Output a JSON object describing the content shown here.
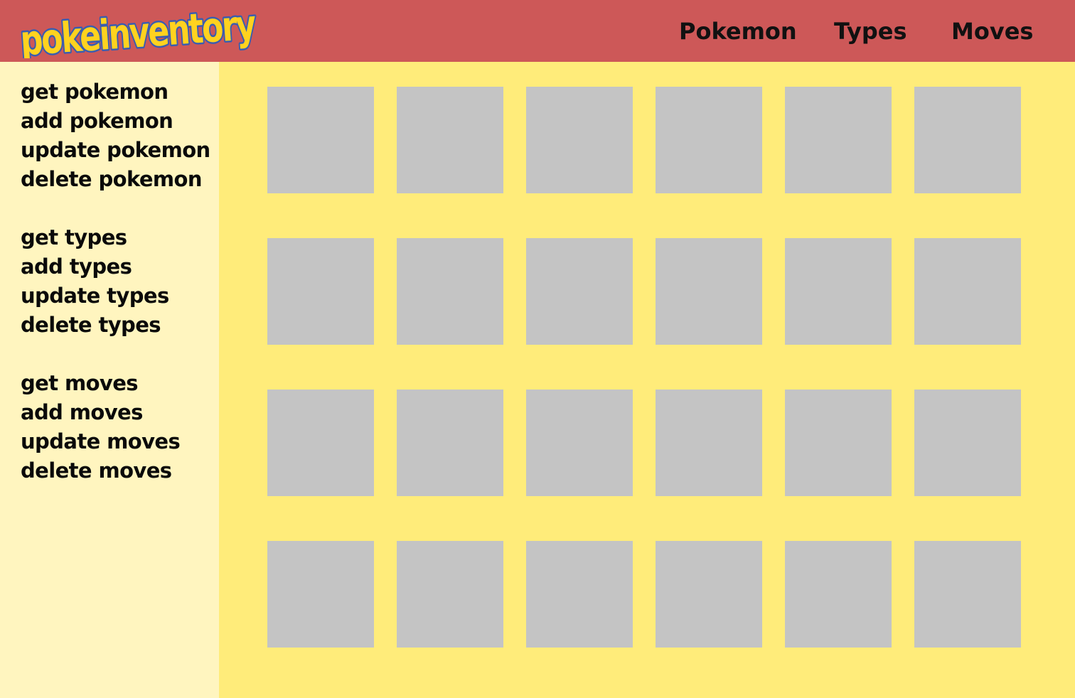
{
  "app": {
    "logo_text": "pokeinventory"
  },
  "nav": {
    "pokemon": "Pokemon",
    "types": "Types",
    "moves": "Moves"
  },
  "sidebar": {
    "groups": [
      {
        "items": [
          "get pokemon",
          "add pokemon",
          "update pokemon",
          "delete pokemon"
        ]
      },
      {
        "items": [
          "get types",
          "add types",
          "update types",
          "delete types"
        ]
      },
      {
        "items": [
          "get moves",
          "add moves",
          "update moves",
          "delete moves"
        ]
      }
    ]
  },
  "grid": {
    "rows": 4,
    "columns": 6
  },
  "colors": {
    "header": "#cd5858",
    "sidebar": "#fff5bf",
    "main": "#ffec7a",
    "card": "#c4c4c4",
    "logo_fill": "#ffd21f",
    "logo_outline": "#3a5db0"
  }
}
